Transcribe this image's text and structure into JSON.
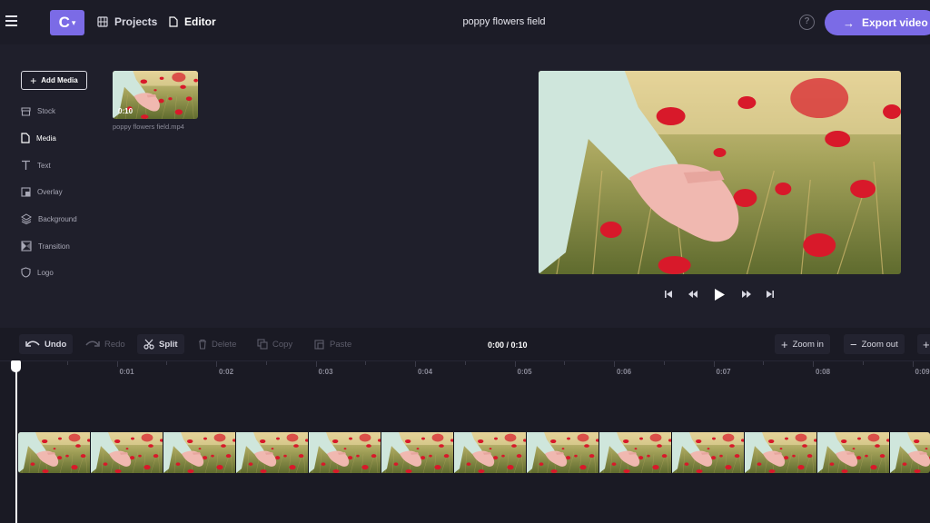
{
  "header": {
    "logo_letter": "C",
    "projects_label": "Projects",
    "editor_label": "Editor",
    "project_title": "poppy flowers field",
    "help_icon": "?",
    "export_label": "Export video"
  },
  "sidebar": {
    "add_media_label": "Add Media",
    "items": [
      {
        "label": "Stock",
        "icon": "stock-icon"
      },
      {
        "label": "Media",
        "icon": "file-icon"
      },
      {
        "label": "Text",
        "icon": "text-icon"
      },
      {
        "label": "Overlay",
        "icon": "overlay-icon"
      },
      {
        "label": "Background",
        "icon": "layers-icon"
      },
      {
        "label": "Transition",
        "icon": "transition-icon"
      },
      {
        "label": "Logo",
        "icon": "shield-icon"
      }
    ]
  },
  "media": {
    "duration": "0:10",
    "filename": "poppy flowers field.mp4"
  },
  "timeline": {
    "undo": "Undo",
    "redo": "Redo",
    "split": "Split",
    "delete": "Delete",
    "copy": "Copy",
    "paste": "Paste",
    "timecode": "0:00 / 0:10",
    "zoom_in": "Zoom in",
    "zoom_out": "Zoom out",
    "ticks": [
      "0:01",
      "0:02",
      "0:03",
      "0:04",
      "0:05",
      "0:06",
      "0:07",
      "0:08",
      "0:09"
    ]
  },
  "colors": {
    "accent": "#7b6be6",
    "background": "#1f1f2b"
  }
}
